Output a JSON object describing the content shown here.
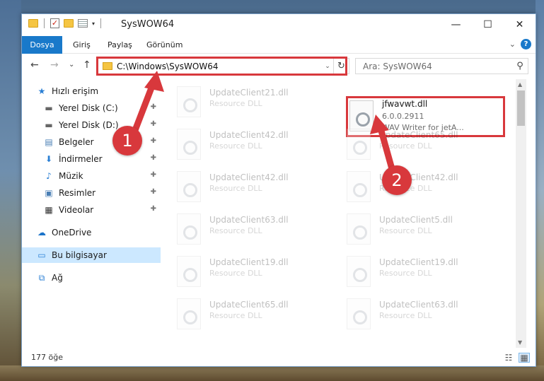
{
  "window": {
    "title": "SysWOW64",
    "controls": {
      "minimize": "—",
      "maximize": "☐",
      "close": "✕"
    }
  },
  "quick_access_toolbar": {
    "dropdown": "▾"
  },
  "ribbon": {
    "tabs": [
      "Dosya",
      "Giriş",
      "Paylaş",
      "Görünüm"
    ],
    "expand": "⌄",
    "help": "?"
  },
  "nav": {
    "back": "←",
    "forward": "→",
    "recent": "⌄",
    "up": "↑",
    "address": "C:\\Windows\\SysWOW64",
    "address_dropdown": "⌄",
    "refresh": "↻",
    "search_placeholder": "Ara: SysWOW64",
    "search_icon": "⚲"
  },
  "sidebar": {
    "items": [
      {
        "label": "Hızlı erişim",
        "icon": "star-icon",
        "glyph": "★",
        "pinned": false
      },
      {
        "label": "Yerel Disk (C:)",
        "icon": "drive-icon",
        "glyph": "▬",
        "pinned": true
      },
      {
        "label": "Yerel Disk (D:)",
        "icon": "drive-icon",
        "glyph": "▬",
        "pinned": true
      },
      {
        "label": "Belgeler",
        "icon": "documents-icon",
        "glyph": "▤",
        "pinned": true
      },
      {
        "label": "İndirmeler",
        "icon": "download-icon",
        "glyph": "⬇",
        "pinned": true
      },
      {
        "label": "Müzik",
        "icon": "music-icon",
        "glyph": "♪",
        "pinned": true
      },
      {
        "label": "Resimler",
        "icon": "pictures-icon",
        "glyph": "▣",
        "pinned": true
      },
      {
        "label": "Videolar",
        "icon": "video-icon",
        "glyph": "▦",
        "pinned": true
      },
      {
        "label": "OneDrive",
        "icon": "cloud-icon",
        "glyph": "☁",
        "pinned": false
      },
      {
        "label": "Bu bilgisayar",
        "icon": "computer-icon",
        "glyph": "▭",
        "pinned": false
      },
      {
        "label": "Ağ",
        "icon": "network-icon",
        "glyph": "⧉",
        "pinned": false
      }
    ],
    "pin_glyph": "📌"
  },
  "files": [
    {
      "name": "UpdateClient21.dll",
      "line2": "Resource DLL",
      "line3": "",
      "faded": true
    },
    {
      "name": "jfwavwt.dll",
      "line2": "6.0.0.2911",
      "line3": "WAV Writer for jetA...",
      "faded": false
    },
    {
      "name": "UpdateClient42.dll",
      "line2": "Resource DLL",
      "line3": "",
      "faded": true
    },
    {
      "name": "UpdateClient65.dll",
      "line2": "Resource DLL",
      "line3": "",
      "faded": true
    },
    {
      "name": "UpdateClient42.dll",
      "line2": "Resource DLL",
      "line3": "",
      "faded": true
    },
    {
      "name": "UpdateClient42.dll",
      "line2": "Resource DLL",
      "line3": "",
      "faded": true
    },
    {
      "name": "UpdateClient63.dll",
      "line2": "Resource DLL",
      "line3": "",
      "faded": true
    },
    {
      "name": "UpdateClient5.dll",
      "line2": "Resource DLL",
      "line3": "",
      "faded": true
    },
    {
      "name": "UpdateClient19.dll",
      "line2": "Resource DLL",
      "line3": "",
      "faded": true
    },
    {
      "name": "UpdateClient19.dll",
      "line2": "Resource DLL",
      "line3": "",
      "faded": true
    },
    {
      "name": "UpdateClient65.dll",
      "line2": "Resource DLL",
      "line3": "",
      "faded": true
    },
    {
      "name": "UpdateClient63.dll",
      "line2": "Resource DLL",
      "line3": "",
      "faded": true
    }
  ],
  "status": {
    "item_count": "177 öğe",
    "view_details": "☷",
    "view_tiles": "▦"
  },
  "annotations": {
    "step1": "1",
    "step2": "2",
    "color": "#d8383c"
  }
}
